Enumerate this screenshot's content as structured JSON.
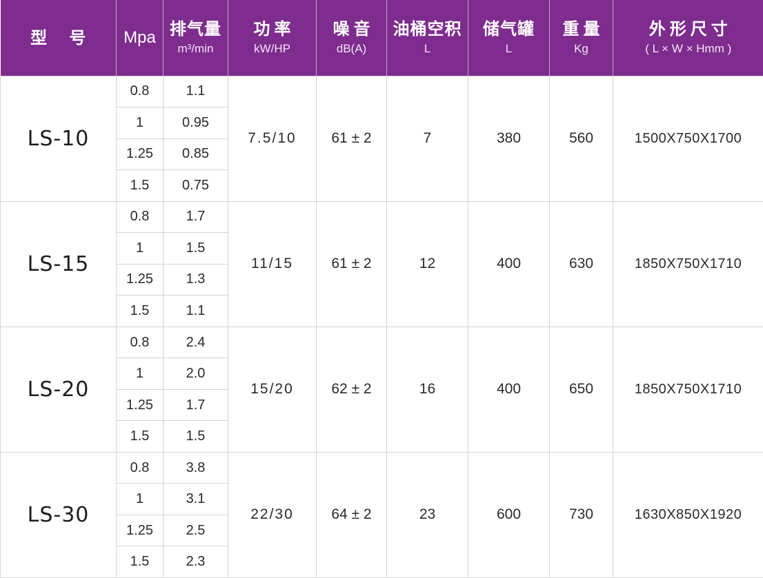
{
  "headers": {
    "model": {
      "title": "型 号"
    },
    "mpa": {
      "title": "Mpa"
    },
    "flow": {
      "title": "排气量",
      "unit": "m³/min"
    },
    "power": {
      "title": "功率",
      "unit": "kW/HP"
    },
    "noise": {
      "title": "噪音",
      "unit": "dB(A)"
    },
    "oil": {
      "title": "油桶空积",
      "unit": "L"
    },
    "tank": {
      "title": "储气罐",
      "unit": "L"
    },
    "weight": {
      "title": "重量",
      "unit": "Kg"
    },
    "dimensions": {
      "title": "外形尺寸",
      "unit": "( L × W × Hmm )"
    }
  },
  "models": [
    {
      "name": "LS-10",
      "rows": [
        {
          "mpa": "0.8",
          "flow": "1.1"
        },
        {
          "mpa": "1",
          "flow": "0.95"
        },
        {
          "mpa": "1.25",
          "flow": "0.85"
        },
        {
          "mpa": "1.5",
          "flow": "0.75"
        }
      ],
      "power": "7.5/10",
      "noise": "61 ± 2",
      "oil": "7",
      "tank": "380",
      "weight": "560",
      "dimensions": "1500X750X1700"
    },
    {
      "name": "LS-15",
      "rows": [
        {
          "mpa": "0.8",
          "flow": "1.7"
        },
        {
          "mpa": "1",
          "flow": "1.5"
        },
        {
          "mpa": "1.25",
          "flow": "1.3"
        },
        {
          "mpa": "1.5",
          "flow": "1.1"
        }
      ],
      "power": "11/15",
      "noise": "61 ± 2",
      "oil": "12",
      "tank": "400",
      "weight": "630",
      "dimensions": "1850X750X1710"
    },
    {
      "name": "LS-20",
      "rows": [
        {
          "mpa": "0.8",
          "flow": "2.4"
        },
        {
          "mpa": "1",
          "flow": "2.0"
        },
        {
          "mpa": "1.25",
          "flow": "1.7"
        },
        {
          "mpa": "1.5",
          "flow": "1.5"
        }
      ],
      "power": "15/20",
      "noise": "62 ± 2",
      "oil": "16",
      "tank": "400",
      "weight": "650",
      "dimensions": "1850X750X1710"
    },
    {
      "name": "LS-30",
      "rows": [
        {
          "mpa": "0.8",
          "flow": "3.8"
        },
        {
          "mpa": "1",
          "flow": "3.1"
        },
        {
          "mpa": "1.25",
          "flow": "2.5"
        },
        {
          "mpa": "1.5",
          "flow": "2.3"
        }
      ],
      "power": "22/30",
      "noise": "64 ± 2",
      "oil": "23",
      "tank": "600",
      "weight": "730",
      "dimensions": "1630X850X1920"
    }
  ],
  "colors": {
    "header_bg": "#7e2c8e",
    "header_text": "#ffffff",
    "grid": "#d4d4d4"
  }
}
